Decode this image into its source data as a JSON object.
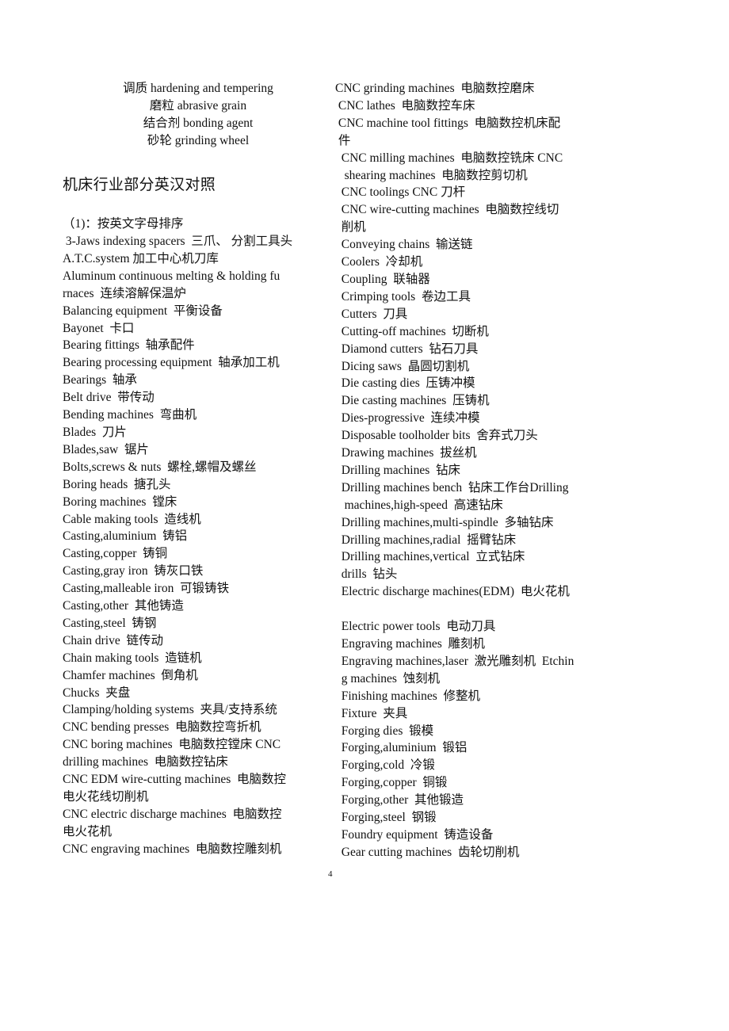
{
  "intro_terms": [
    "调质 hardening and tempering",
    "磨粒 abrasive grain",
    "结合剂 bonding agent",
    "砂轮 grinding wheel"
  ],
  "heading": "机床行业部分英汉对照",
  "subheading": "（1)：按英文字母排序",
  "left_column": [
    " 3-Jaws indexing spacers  三爪、 分割工具头",
    "A.T.C.system 加工中心机刀库",
    "Aluminum continuous melting & holding fu",
    "rnaces  连续溶解保温炉",
    "Balancing equipment  平衡设备",
    "Bayonet  卡口",
    "Bearing fittings  轴承配件",
    "Bearing processing equipment  轴承加工机",
    "Bearings  轴承",
    "Belt drive  带传动",
    "Bending machines  弯曲机",
    "Blades  刀片",
    "Blades,saw  锯片",
    "Bolts,screws & nuts  螺栓,螺帽及螺丝",
    "Boring heads  搪孔头",
    "Boring machines  镗床",
    "Cable making tools  造线机",
    "Casting,aluminium  铸铝",
    "Casting,copper  铸铜",
    "Casting,gray iron  铸灰口铁",
    "Casting,malleable iron  可锻铸铁",
    "Casting,other  其他铸造",
    "Casting,steel  铸钢",
    "Chain drive  链传动",
    "Chain making tools  造链机",
    "Chamfer machines  倒角机",
    "Chucks  夹盘",
    "Clamping/holding systems  夹具/支持系统",
    "CNC bending presses  电脑数控弯折机",
    "CNC boring machines  电脑数控镗床 CNC",
    "drilling machines  电脑数控钻床",
    "CNC EDM wire-cutting machines  电脑数控",
    "电火花线切削机",
    "CNC electric discharge machines  电脑数控",
    "电火花机",
    "CNC engraving machines  电脑数控雕刻机"
  ],
  "right_column": [
    "CNC grinding machines  电脑数控磨床",
    " CNC lathes  电脑数控车床",
    " CNC machine tool fittings  电脑数控机床配",
    " 件",
    "  CNC milling machines  电脑数控铣床 CNC",
    "   shearing machines  电脑数控剪切机",
    "  CNC toolings CNC 刀杆",
    "  CNC wire-cutting machines  电脑数控线切",
    "  削机",
    "  Conveying chains  输送链",
    "  Coolers  冷却机",
    "  Coupling  联轴器",
    "  Crimping tools  卷边工具",
    "  Cutters  刀具",
    "  Cutting-off machines  切断机",
    "  Diamond cutters  钻石刀具",
    "  Dicing saws  晶圆切割机",
    "  Die casting dies  压铸冲模",
    "  Die casting machines  压铸机",
    "  Dies-progressive  连续冲模",
    "  Disposable toolholder bits  舍弃式刀头",
    "  Drawing machines  拔丝机",
    "  Drilling machines  钻床",
    "  Drilling machines bench  钻床工作台Drilling",
    "   machines,high-speed  高速钻床",
    "  Drilling machines,multi-spindle  多轴钻床",
    "  Drilling machines,radial  摇臂钻床",
    "  Drilling machines,vertical  立式钻床",
    "  drills  钻头",
    "  Electric discharge machines(EDM)  电火花机",
    "",
    "  Electric power tools  电动刀具",
    "  Engraving machines  雕刻机",
    "  Engraving machines,laser  激光雕刻机  Etchin",
    "  g machines  蚀刻机",
    "  Finishing machines  修整机",
    "  Fixture  夹具",
    "  Forging dies  锻模",
    "  Forging,aluminium  锻铝",
    "  Forging,cold  冷锻",
    "  Forging,copper  铜锻",
    "  Forging,other  其他锻造",
    "  Forging,steel  钢锻",
    "  Foundry equipment  铸造设备",
    "  Gear cutting machines  齿轮切削机"
  ],
  "page_number": "4"
}
